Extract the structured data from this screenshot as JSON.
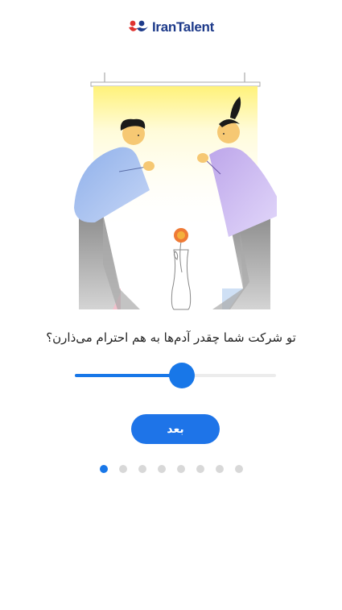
{
  "brand": {
    "name": "IranTalent"
  },
  "onboarding": {
    "question": "تو شرکت شما چقدر آدم‌ها به هم احترام می‌ذارن؟",
    "slider": {
      "value": 0.53
    },
    "next_label": "بعد",
    "pager": {
      "total": 8,
      "current": 1
    }
  },
  "colors": {
    "accent": "#1877e8",
    "brand_blue": "#1d3a8a",
    "brand_red": "#e0322f"
  }
}
